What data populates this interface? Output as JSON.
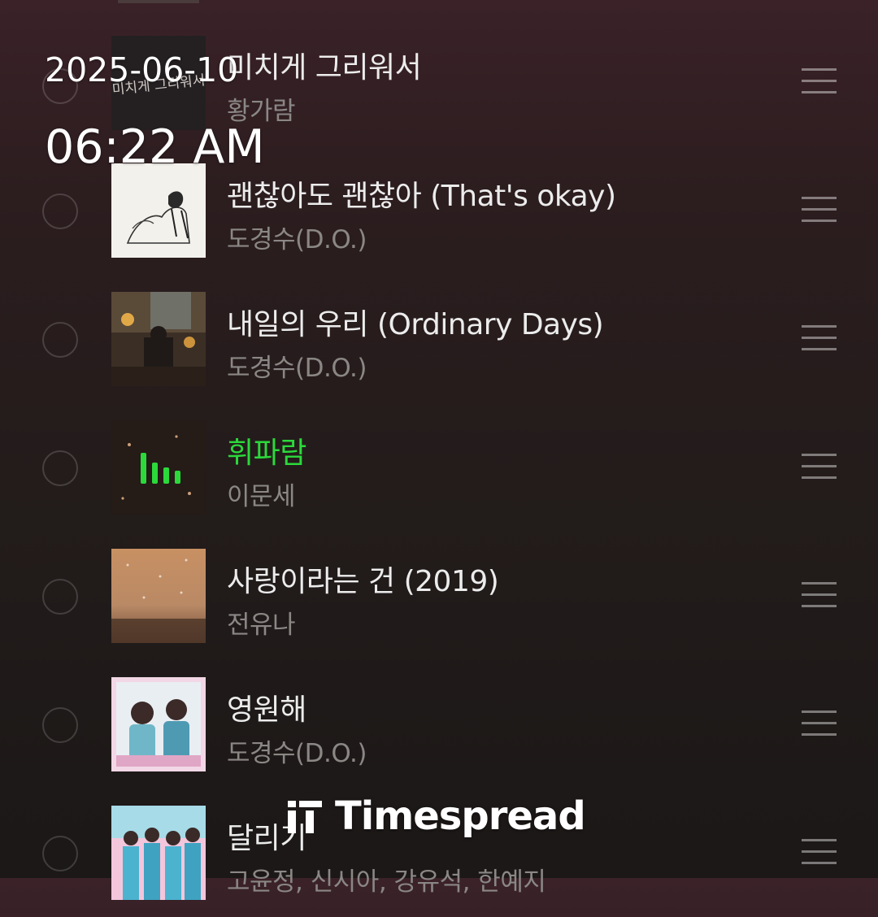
{
  "overlay": {
    "date": "2025-06-10",
    "time": "06:22 AM",
    "watermark": "Timespread"
  },
  "colors": {
    "playing_accent": "#2bd93b",
    "title_text": "#ececec",
    "artist_text": "#8a8785"
  },
  "playlist": {
    "now_playing_index": 3,
    "songs": [
      {
        "title": "미치게 그리워서",
        "artist": "황가람",
        "art_text": "미치게 그리워서"
      },
      {
        "title": "괜찮아도 괜찮아 (That's okay)",
        "artist": "도경수(D.O.)"
      },
      {
        "title": "내일의 우리 (Ordinary Days)",
        "artist": "도경수(D.O.)"
      },
      {
        "title": "휘파람",
        "artist": "이문세",
        "playing": true
      },
      {
        "title": "사랑이라는 건 (2019)",
        "artist": "전유나"
      },
      {
        "title": "영원해",
        "artist": "도경수(D.O.)"
      },
      {
        "title": "달리기",
        "artist": "고윤정, 신시아, 강유석, 한예지"
      }
    ]
  },
  "icons": {
    "row_handle": "drag-handle-icon",
    "row_select": "select-circle-icon",
    "playing_indicator": "equalizer-bars-icon",
    "watermark_logo": "timespread-logo-icon"
  }
}
